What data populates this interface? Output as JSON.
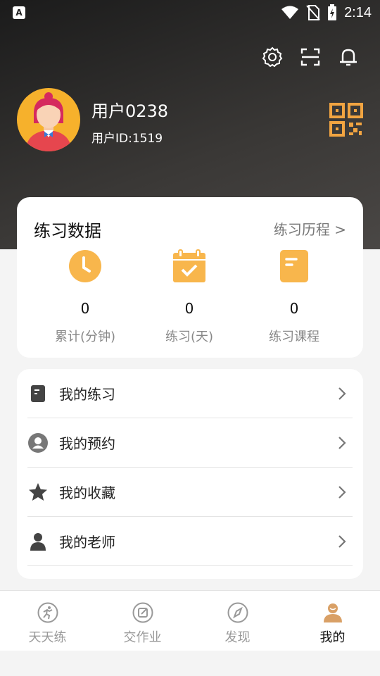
{
  "status_bar": {
    "time": "2:14",
    "notification_letter": "A"
  },
  "header": {
    "icons": [
      "gear-icon",
      "scan-icon",
      "bell-icon"
    ],
    "user": {
      "name": "用户0238",
      "id_text": "用户ID:1519"
    },
    "qr_icon": "qr-code-icon"
  },
  "practice_stats": {
    "title": "练习数据",
    "history_link": "练习历程 >",
    "items": [
      {
        "value": "0",
        "label": "累计(分钟)",
        "icon": "clock-icon"
      },
      {
        "value": "0",
        "label": "练习(天)",
        "icon": "calendar-check-icon"
      },
      {
        "value": "0",
        "label": "练习课程",
        "icon": "document-icon"
      }
    ]
  },
  "menu": [
    {
      "label": "我的练习",
      "icon": "practice-book-icon"
    },
    {
      "label": "我的预约",
      "icon": "appointment-user-icon"
    },
    {
      "label": "我的收藏",
      "icon": "star-icon"
    },
    {
      "label": "我的老师",
      "icon": "person-icon"
    }
  ],
  "tabs": [
    {
      "label": "天天练",
      "icon": "runner-icon",
      "active": false
    },
    {
      "label": "交作业",
      "icon": "edit-icon",
      "active": false
    },
    {
      "label": "发现",
      "icon": "compass-icon",
      "active": false
    },
    {
      "label": "我的",
      "icon": "profile-icon",
      "active": true
    }
  ],
  "colors": {
    "accent": "#f8b64c",
    "header_dark": "#2a2826",
    "active_tab_icon": "#d9a066"
  }
}
